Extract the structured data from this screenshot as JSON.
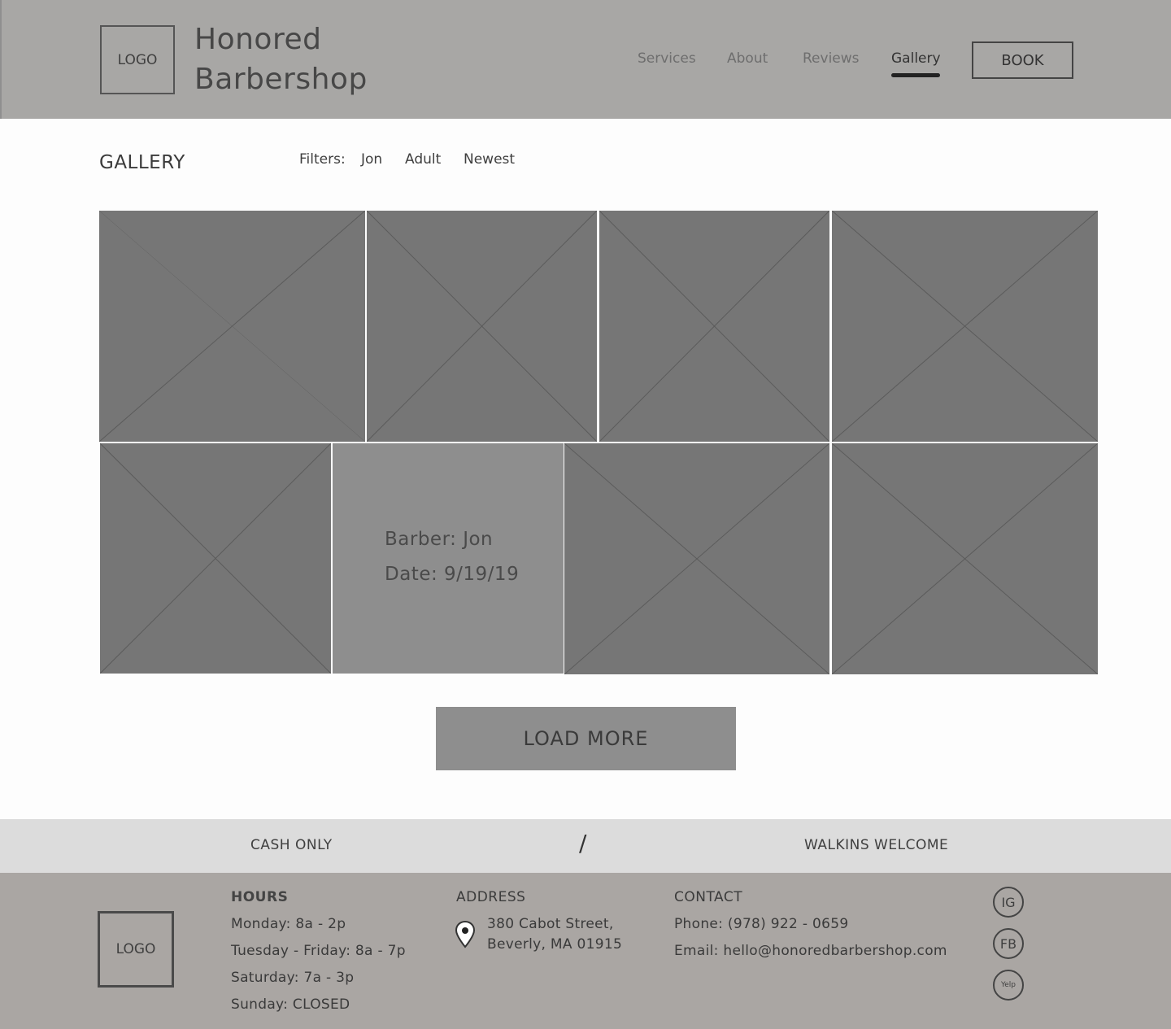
{
  "header": {
    "logo": "LOGO",
    "brand_line1": "Honored",
    "brand_line2": "Barbershop",
    "nav": [
      "Services",
      "About",
      "Reviews",
      "Gallery"
    ],
    "active_nav": "Gallery",
    "book_label": "BOOK"
  },
  "gallery": {
    "title": "GALLERY",
    "filters_label": "Filters:",
    "filters": [
      "Jon",
      "Adult",
      "Newest"
    ],
    "hover_card": {
      "barber": "Barber: Jon",
      "date": "Date: 9/19/19"
    },
    "load_more": "LOAD MORE"
  },
  "info_bar": {
    "left": "CASH ONLY",
    "separator": "/",
    "right": "WALKINS WELCOME"
  },
  "footer": {
    "logo": "LOGO",
    "hours": {
      "title": "HOURS",
      "lines": [
        "Monday: 8a - 2p",
        "Tuesday - Friday: 8a - 7p",
        "Saturday: 7a - 3p",
        "Sunday: CLOSED"
      ]
    },
    "address": {
      "title": "ADDRESS",
      "line1": "380 Cabot Street,",
      "line2": "Beverly, MA 01915"
    },
    "contact": {
      "title": "CONTACT",
      "phone": "Phone: (978) 922 - 0659",
      "email": "Email: hello@honoredbarbershop.com"
    },
    "social": [
      "IG",
      "FB",
      "Yelp"
    ]
  },
  "colors": {
    "header_bg": "#a8a7a5",
    "tile": "#767676",
    "hover_tile": "#8e8e8e",
    "info_bar": "#dcdcdc",
    "footer_bg": "#aaa6a3"
  }
}
